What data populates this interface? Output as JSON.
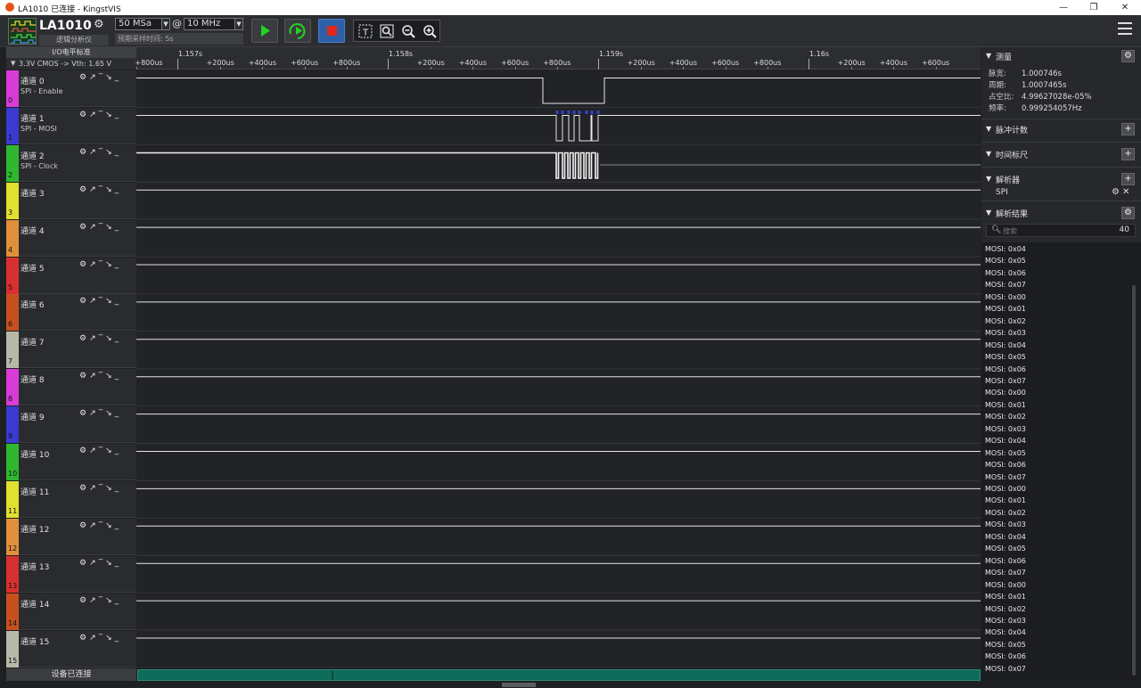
{
  "window": {
    "title": "LA1010 已连接 - KingstVIS",
    "controls": [
      "—",
      "❐",
      "✕"
    ]
  },
  "toolbar": {
    "device_name": "LA1010",
    "device_sub": "逻辑分析仪",
    "sample_rate": "50 MSa",
    "at": "@",
    "sample_depth": "10 MHz",
    "pre_time": "预期采样时间: 5s"
  },
  "io": {
    "header": "I/O电平标准",
    "level": "3.3V CMOS  -> Vth: 1.65 V"
  },
  "ruler": {
    "majors": [
      "1.157s",
      "1.158s",
      "1.159s",
      "1.16s"
    ],
    "minors": [
      "+800us",
      "+200us",
      "+400us",
      "+600us",
      "+800us",
      "+200us",
      "+400us",
      "+600us",
      "+800us",
      "+200us",
      "+400us",
      "+600us",
      "+800us",
      "+200us",
      "+400us",
      "+600us"
    ]
  },
  "channels": [
    {
      "name": "通道 0",
      "sub": "SPI - Enable",
      "index": "0",
      "color": "#d93bd9"
    },
    {
      "name": "通道 1",
      "sub": "SPI - MOSI",
      "index": "1",
      "color": "#3a3ad0"
    },
    {
      "name": "通道 2",
      "sub": "SPI - Clock",
      "index": "2",
      "color": "#2fb82f"
    },
    {
      "name": "通道 3",
      "sub": "",
      "index": "3",
      "color": "#e0e030"
    },
    {
      "name": "通道 4",
      "sub": "",
      "index": "4",
      "color": "#e0903a"
    },
    {
      "name": "通道 5",
      "sub": "",
      "index": "5",
      "color": "#d83030"
    },
    {
      "name": "通道 6",
      "sub": "",
      "index": "6",
      "color": "#c8501f"
    },
    {
      "name": "通道 7",
      "sub": "",
      "index": "7",
      "color": "#b8b8a8"
    },
    {
      "name": "通道 8",
      "sub": "",
      "index": "8",
      "color": "#d93bd9"
    },
    {
      "name": "通道 9",
      "sub": "",
      "index": "9",
      "color": "#3a3ad0"
    },
    {
      "name": "通道 10",
      "sub": "",
      "index": "10",
      "color": "#2fb82f"
    },
    {
      "name": "通道 11",
      "sub": "",
      "index": "11",
      "color": "#e0e030"
    },
    {
      "name": "通道 12",
      "sub": "",
      "index": "12",
      "color": "#e0903a"
    },
    {
      "name": "通道 13",
      "sub": "",
      "index": "13",
      "color": "#d83030"
    },
    {
      "name": "通道 14",
      "sub": "",
      "index": "14",
      "color": "#c8501f"
    },
    {
      "name": "通道 15",
      "sub": "",
      "index": "15",
      "color": "#b8b8a8"
    }
  ],
  "channel_tools": [
    "⚙",
    "↗",
    "‾",
    "↘",
    "_"
  ],
  "status": {
    "connected": "设备已连接"
  },
  "panel": {
    "measure_title": "测量",
    "measurements": [
      {
        "k": "脉宽:",
        "v": "1.000746s"
      },
      {
        "k": "周期:",
        "v": "1.0007465s"
      },
      {
        "k": "占空比:",
        "v": "4.99627028e-05%"
      },
      {
        "k": "频率:",
        "v": "0.999254057Hz"
      }
    ],
    "pulse_count": "脉冲计数",
    "timing": "时间标尺",
    "decoders_title": "解析器",
    "decoder": "SPI",
    "results_title": "解析结果",
    "search_placeholder": "搜索",
    "result_count": "40",
    "results": [
      "MOSI: 0x04",
      "MOSI: 0x05",
      "MOSI: 0x06",
      "MOSI: 0x07",
      "MOSI: 0x00",
      "MOSI: 0x01",
      "MOSI: 0x02",
      "MOSI: 0x03",
      "MOSI: 0x04",
      "MOSI: 0x05",
      "MOSI: 0x06",
      "MOSI: 0x07",
      "MOSI: 0x00",
      "MOSI: 0x01",
      "MOSI: 0x02",
      "MOSI: 0x03",
      "MOSI: 0x04",
      "MOSI: 0x05",
      "MOSI: 0x06",
      "MOSI: 0x07",
      "MOSI: 0x00",
      "MOSI: 0x01",
      "MOSI: 0x02",
      "MOSI: 0x03",
      "MOSI: 0x04",
      "MOSI: 0x05",
      "MOSI: 0x06",
      "MOSI: 0x07",
      "MOSI: 0x00",
      "MOSI: 0x01",
      "MOSI: 0x02",
      "MOSI: 0x03",
      "MOSI: 0x04",
      "MOSI: 0x05",
      "MOSI: 0x06",
      "MOSI: 0x07"
    ]
  }
}
